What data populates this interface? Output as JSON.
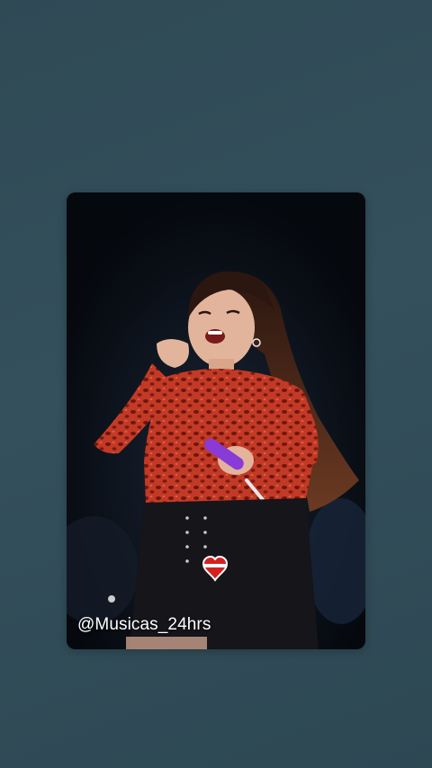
{
  "story": {
    "background_color": "#304b56",
    "card_background": "#0a0f18",
    "watermark_text": "@Musicas_24hrs",
    "watermark_color": "#ffffff",
    "photo_icon": "singer-on-stage-photo"
  }
}
